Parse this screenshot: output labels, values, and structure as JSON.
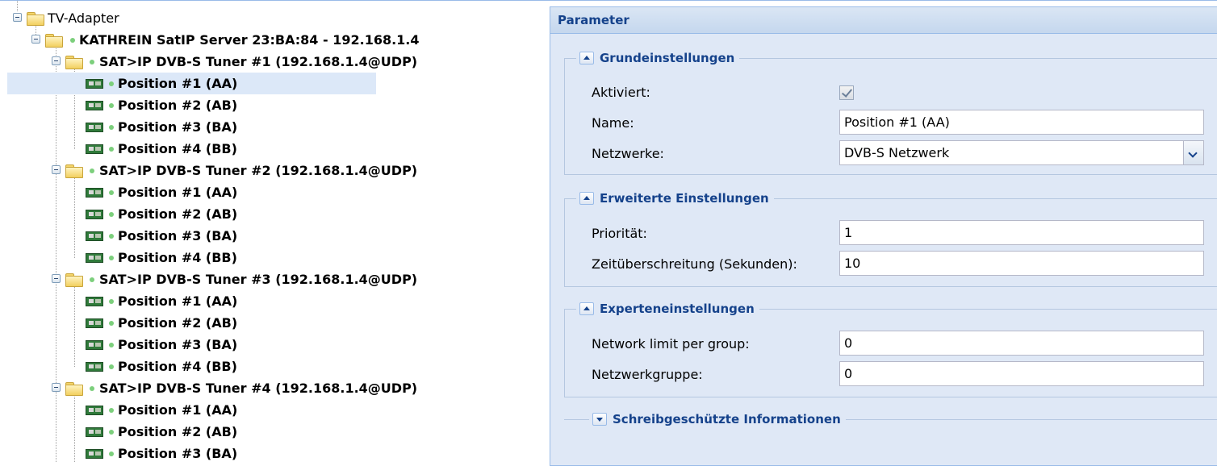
{
  "tree": {
    "root": "TV-Adapter",
    "server": "KATHREIN SatIP Server 23:BA:84 - 192.168.1.4",
    "tuners": [
      {
        "label": "SAT>IP DVB-S Tuner #1 (192.168.1.4@UDP)",
        "positions": [
          "Position #1 (AA)",
          "Position #2 (AB)",
          "Position #3 (BA)",
          "Position #4 (BB)"
        ]
      },
      {
        "label": "SAT>IP DVB-S Tuner #2 (192.168.1.4@UDP)",
        "positions": [
          "Position #1 (AA)",
          "Position #2 (AB)",
          "Position #3 (BA)",
          "Position #4 (BB)"
        ]
      },
      {
        "label": "SAT>IP DVB-S Tuner #3 (192.168.1.4@UDP)",
        "positions": [
          "Position #1 (AA)",
          "Position #2 (AB)",
          "Position #3 (BA)",
          "Position #4 (BB)"
        ]
      },
      {
        "label": "SAT>IP DVB-S Tuner #4 (192.168.1.4@UDP)",
        "positions": [
          "Position #1 (AA)",
          "Position #2 (AB)",
          "Position #3 (BA)"
        ]
      }
    ],
    "selected": "Position #1 (AA)",
    "status_color": "#7ccf7c"
  },
  "panel": {
    "title": "Parameter",
    "sections": {
      "basic": {
        "title": "Grundeinstellungen",
        "enabled_label": "Aktiviert:",
        "enabled": true,
        "name_label": "Name:",
        "name_value": "Position #1 (AA)",
        "networks_label": "Netzwerke:",
        "networks_value": "DVB-S Netzwerk"
      },
      "advanced": {
        "title": "Erweiterte Einstellungen",
        "priority_label": "Priorität:",
        "priority_value": "1",
        "timeout_label": "Zeitüberschreitung (Sekunden):",
        "timeout_value": "10"
      },
      "expert": {
        "title": "Experteneinstellungen",
        "limit_label": "Network limit per group:",
        "limit_value": "0",
        "group_label": "Netzwerkgruppe:",
        "group_value": "0"
      },
      "readonly": {
        "title": "Schreibgeschützte Informationen"
      }
    }
  },
  "colors": {
    "accent": "#15428b",
    "panel_bg": "#dfe8f6",
    "border": "#99bbe8",
    "selection": "#dce8f8"
  }
}
